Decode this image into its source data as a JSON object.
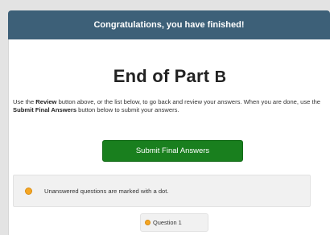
{
  "banner": {
    "text": "Congratulations, you have finished!"
  },
  "main": {
    "title": "End of Part",
    "part": "B",
    "desc_1": "Use the ",
    "desc_review": "Review",
    "desc_2": " button above, or the list below, to go back and review your answers. When you are done, use the ",
    "desc_submit": "Submit Final Answers",
    "desc_3": " button below to submit your answers.",
    "submit_label": "Submit Final Answers",
    "note": "Unanswered questions are marked with a dot.",
    "questions": [
      {
        "label": "Question 1",
        "unanswered": true
      }
    ]
  },
  "colors": {
    "banner": "#3d6078",
    "submit": "#197f1e",
    "unanswered_dot": "#f5a623"
  }
}
